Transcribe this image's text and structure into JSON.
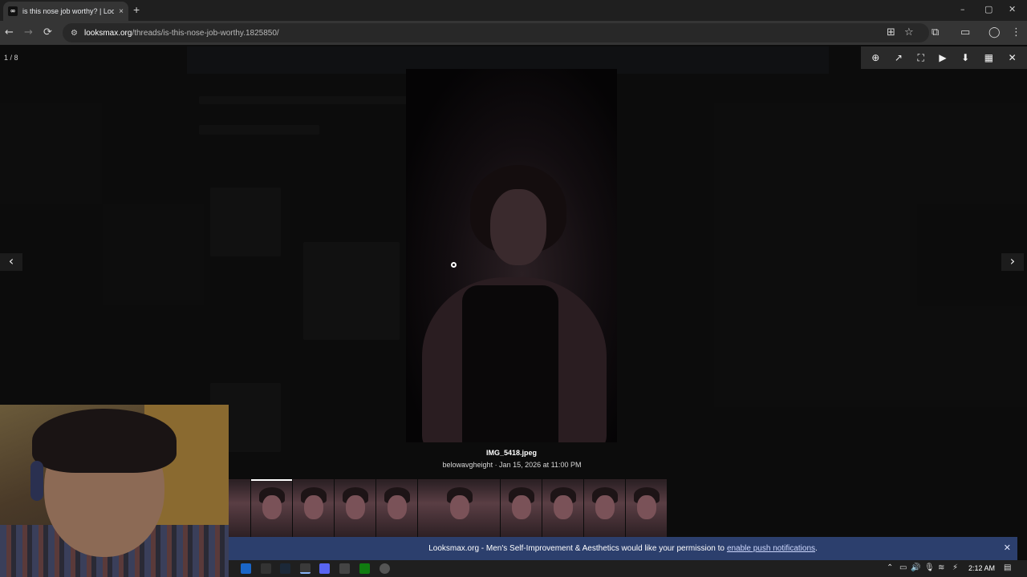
{
  "browser": {
    "tab_title": "is this nose job worthy? | Looksmax",
    "favicon_glyph": "∞",
    "tab_close": "×",
    "new_tab": "+",
    "url_host": "looksmax.org",
    "url_path": "/threads/is-this-nose-job-worthy.1825850/",
    "nav": {
      "back": "←",
      "forward": "→",
      "reload": "⟳",
      "site_info": "⚙"
    },
    "toolbar_icons": {
      "install": "⊞",
      "bookmark": "☆",
      "extensions": "⧉",
      "split": "▭",
      "profile": "◯",
      "menu": "⋮"
    },
    "window_controls": {
      "minimize": "–",
      "maximize": "▢",
      "close": "✕"
    }
  },
  "lightbox": {
    "counter": "1 / 8",
    "toolbar": {
      "zoom": "⊕",
      "open_new": "↗",
      "fullscreen": "⛶",
      "slideshow": "▶",
      "download": "⬇",
      "thumbnails": "▦",
      "close": "✕"
    },
    "prev_arrow": "‹",
    "next_arrow": "›",
    "filename": "IMG_5418.jpeg",
    "meta": "belowavgheight · Jan 15, 2026 at 11:00 PM",
    "thumbnails_count": 10,
    "active_thumbnail": 1
  },
  "push_notice": {
    "text": "Looksmax.org - Men's Self-Improvement & Aesthetics would like your permission to",
    "link": "enable push notifications",
    "suffix": ".",
    "close": "✕"
  },
  "taskbar": {
    "time": "2:12 AM",
    "tray": {
      "chevron": "⌃",
      "battery": "▭",
      "volume": "🔊",
      "mic": "🎙",
      "wifi": "≋",
      "network": "⚡",
      "notification": "▤"
    }
  }
}
